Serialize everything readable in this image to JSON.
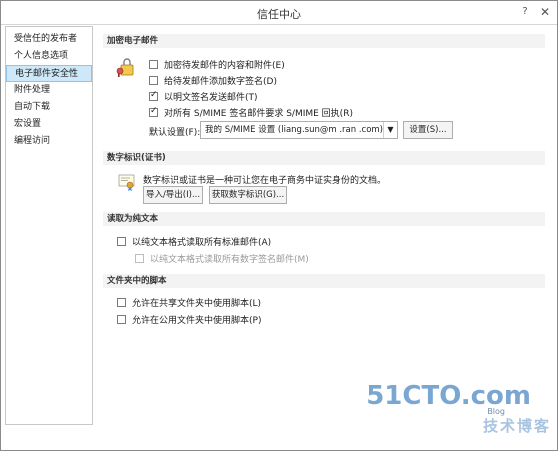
{
  "window": {
    "title": "信任中心",
    "help": "?",
    "close": "✕"
  },
  "sidebar": {
    "items": [
      {
        "label": "受信任的发布者"
      },
      {
        "label": "个人信息选项"
      },
      {
        "label": "电子邮件安全性",
        "active": true
      },
      {
        "label": "附件处理"
      },
      {
        "label": "自动下载"
      },
      {
        "label": "宏设置"
      },
      {
        "label": "编程访问"
      }
    ]
  },
  "encrypted": {
    "header": "加密电子邮件",
    "icon": "lock-key-envelope-icon",
    "options": [
      {
        "label": "加密待发邮件的内容和附件(E)",
        "checked": false
      },
      {
        "label": "给待发邮件添加数字签名(D)",
        "checked": false
      },
      {
        "label": "以明文签名发送邮件(T)",
        "checked": true
      },
      {
        "label": "对所有 S/MIME 签名邮件要求 S/MIME 回执(R)",
        "checked": true
      }
    ],
    "default_setting_label": "默认设置(F):",
    "default_setting_value": "我的 S/MIME 设置 (liang.sun@m  .ran  .com)",
    "settings_button": "设置(S)..."
  },
  "digital_id": {
    "header": "数字标识(证书)",
    "icon": "certificate-icon",
    "description": "数字标识或证书是一种可让您在电子商务中证实身份的文档。",
    "import_button": "导入/导出(I)...",
    "get_button": "获取数字标识(G)..."
  },
  "plain_text": {
    "header": "读取为纯文本",
    "options": [
      {
        "label": "以纯文本格式读取所有标准邮件(A)",
        "checked": false,
        "disabled": false
      },
      {
        "label": "以纯文本格式读取所有数字签名邮件(M)",
        "checked": false,
        "disabled": true
      }
    ]
  },
  "script": {
    "header": "文件夹中的脚本",
    "options": [
      {
        "label": "允许在共享文件夹中使用脚本(L)",
        "checked": false
      },
      {
        "label": "允许在公用文件夹中使用脚本(P)",
        "checked": false
      }
    ]
  },
  "watermark": {
    "big": "51CTO.com",
    "small": "技术博客",
    "tag": "Blog"
  }
}
